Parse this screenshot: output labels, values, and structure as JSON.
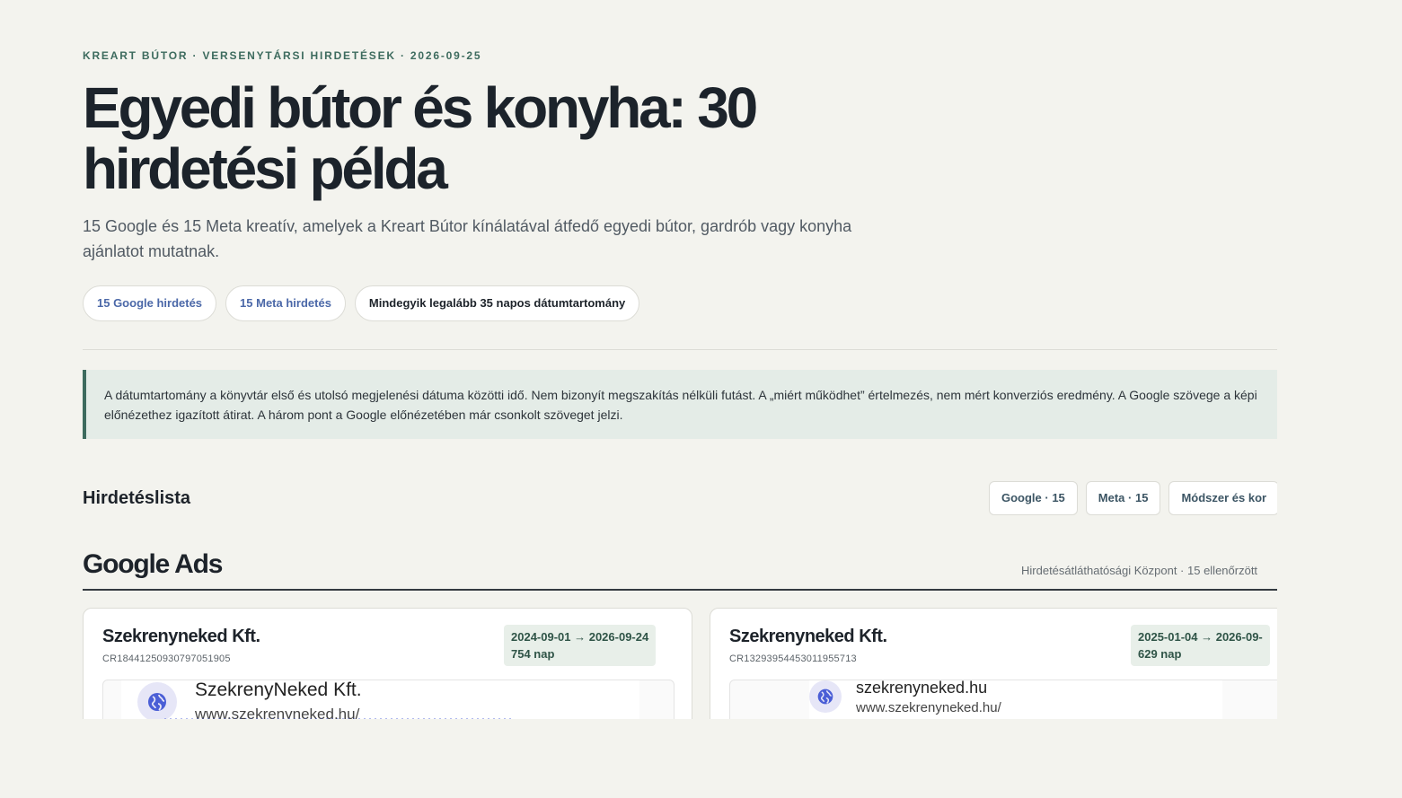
{
  "header": {
    "eyebrow": "KREART BÚTOR · VERSENYTÁRSI HIRDETÉSEK · 2026-09-25",
    "title": "Egyedi bútor és konyha: 30 hirdetési példa",
    "subtitle": "15 Google és 15 Meta kreatív, amelyek a Kreart Bútor kínálatával átfedő egyedi bútor, gardrób vagy konyha ajánlatot mutatnak."
  },
  "chips": [
    {
      "label": "15 Google hirdetés"
    },
    {
      "label": "15 Meta hirdetés"
    },
    {
      "label": "Mindegyik legalább 35 napos dátumtartomány"
    }
  ],
  "notice": {
    "text": "A dátumtartomány a könyvtár első és utolsó megjelenési dátuma közötti idő. Nem bizonyít megszakítás nélküli futást. A „miért működhet” értelmezés, nem mért konverziós eredmény. A Google szövege a képi előnézethez igazított átirat. A három pont a Google előnézetében már csonkolt szöveget jelzi."
  },
  "list": {
    "title": "Hirdetéslista",
    "filters": [
      {
        "label": "Google · 15"
      },
      {
        "label": "Meta · 15"
      },
      {
        "label": "Módszer és kor"
      }
    ]
  },
  "section": {
    "title": "Google Ads",
    "meta": "Hirdetésátláthatósági Központ · 15 ellenőrzött"
  },
  "cards": [
    {
      "advertiser": "Szekrenyneked Kft.",
      "id": "CR18441250930797051905",
      "date_range": "2024-09-01 → 2026-09-24",
      "days": "754 nap",
      "preview_name": "SzekrenyNeked Kft.",
      "preview_url": "www.szekrenyneked.hu/"
    },
    {
      "advertiser": "Szekrenyneked Kft.",
      "id": "CR13293954453011955713",
      "date_range": "2025-01-04 → 2026-09-",
      "days": "629 nap",
      "preview_name": "szekrenyneked.hu",
      "preview_url": "www.szekrenyneked.hu/"
    }
  ],
  "icons": {
    "preview_logo": "globe-icon"
  },
  "colors": {
    "accent": "#3d6b5e",
    "google_chip": "#4b68a8",
    "notice_bg": "#e4ece7",
    "globe": "#4a5ed6"
  }
}
